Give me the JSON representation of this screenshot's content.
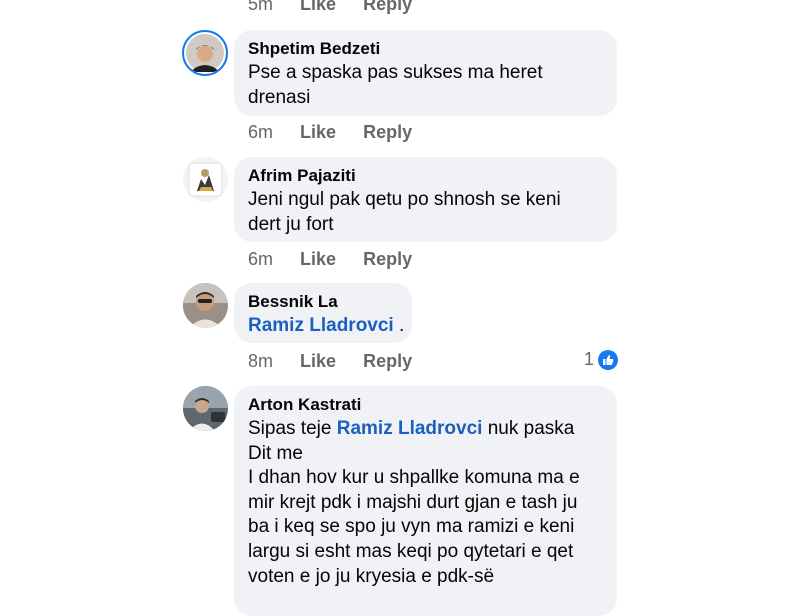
{
  "top_actions": {
    "time": "5m",
    "like": "Like",
    "reply": "Reply"
  },
  "comments": [
    {
      "author": "Shpetim Bedzeti",
      "lines": [
        "Pse a spaska pas sukses ma heret",
        "drenasi"
      ],
      "time": "6m",
      "like": "Like",
      "reply": "Reply"
    },
    {
      "author": "Afrim Pajaziti",
      "lines": [
        "Jeni ngul pak qetu po shnosh se keni",
        "dert ju fort"
      ],
      "time": "6m",
      "like": "Like",
      "reply": "Reply"
    },
    {
      "author": "Bessnik La",
      "mention": "Ramiz Lladrovci",
      "after_mention": " .",
      "time": "8m",
      "like": "Like",
      "reply": "Reply",
      "reaction_count": "1"
    },
    {
      "author": "Arton Kastrati",
      "line1_before": "Sipas teje ",
      "mention": "Ramiz Lladrovci",
      "line1_after": " nuk paska",
      "lines": [
        "Dit me",
        "I dhan hov kur u shpallke komuna ma e",
        "mir krejt pdk i majshi durt gjan e tash ju",
        "ba i keq se spo ju vyn ma ramizi e keni",
        "largu si esht mas keqi po qytetari e qet",
        "voten e jo ju kryesia e pdk-së"
      ]
    }
  ],
  "colors": {
    "bubble": "#f0f2f5",
    "mention": "#1b5fbf",
    "meta": "#65676b",
    "like_blue": "#1877f2"
  }
}
